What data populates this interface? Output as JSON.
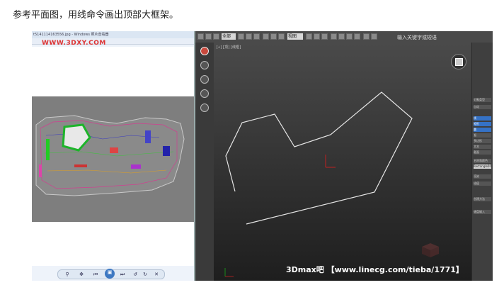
{
  "caption": "参考平面图，用线命令画出顶部大框架。",
  "viewer": {
    "title": "t5141114163556.jpg - Windows 照片查看器",
    "watermark": "WWW.3DXY.COM"
  },
  "max": {
    "toolbar": {
      "dropdown1": "全部",
      "dropdown2": "视图"
    },
    "topright_text": "输入关键字或短语",
    "viewport_label": "[+][顶][线框]",
    "footer_text": "3Dmax吧 【www.linecg.com/tieba/1771】",
    "panel_rows": [
      "对象类型",
      "自动",
      "线",
      "矩形",
      "圆",
      "弧",
      "多边形",
      "文本",
      "截面",
      "名称和颜色",
      "Rectangle001",
      "渲染",
      "插值",
      "创建方法",
      "键盘输入"
    ]
  },
  "colors": {
    "caption": "#222222",
    "viewport_top": "#4a4a4a",
    "viewport_bottom": "#1e1e1e",
    "spline": "#e6e6e6",
    "accent_blue": "#3572c6"
  }
}
